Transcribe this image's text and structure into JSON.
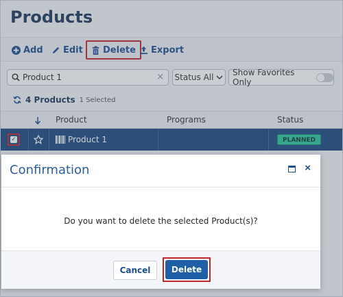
{
  "page": {
    "title": "Products"
  },
  "toolbar": {
    "add_label": "Add",
    "edit_label": "Edit",
    "delete_label": "Delete",
    "export_label": "Export"
  },
  "filters": {
    "search_value": "Product 1",
    "clear_glyph": "×",
    "status_label": "Status All",
    "favorites_label": "Show Favorites Only",
    "favorites_on": false
  },
  "summary": {
    "count_label": "4 Products",
    "selected_label": "1 Selected"
  },
  "grid": {
    "columns": [
      "Product",
      "Programs",
      "Status"
    ],
    "rows": [
      {
        "checked": true,
        "favorite": false,
        "product": "Product 1",
        "programs": "",
        "status": "PLANNED"
      }
    ]
  },
  "modal": {
    "title": "Confirmation",
    "message": "Do you want to delete the selected Product(s)?",
    "cancel_label": "Cancel",
    "confirm_label": "Delete",
    "close_glyph": "×"
  },
  "colors": {
    "brand": "#1f4f8f",
    "selected_row": "#1d4b82",
    "status_planned": "#2ec7a0",
    "highlight": "#c0272d"
  }
}
